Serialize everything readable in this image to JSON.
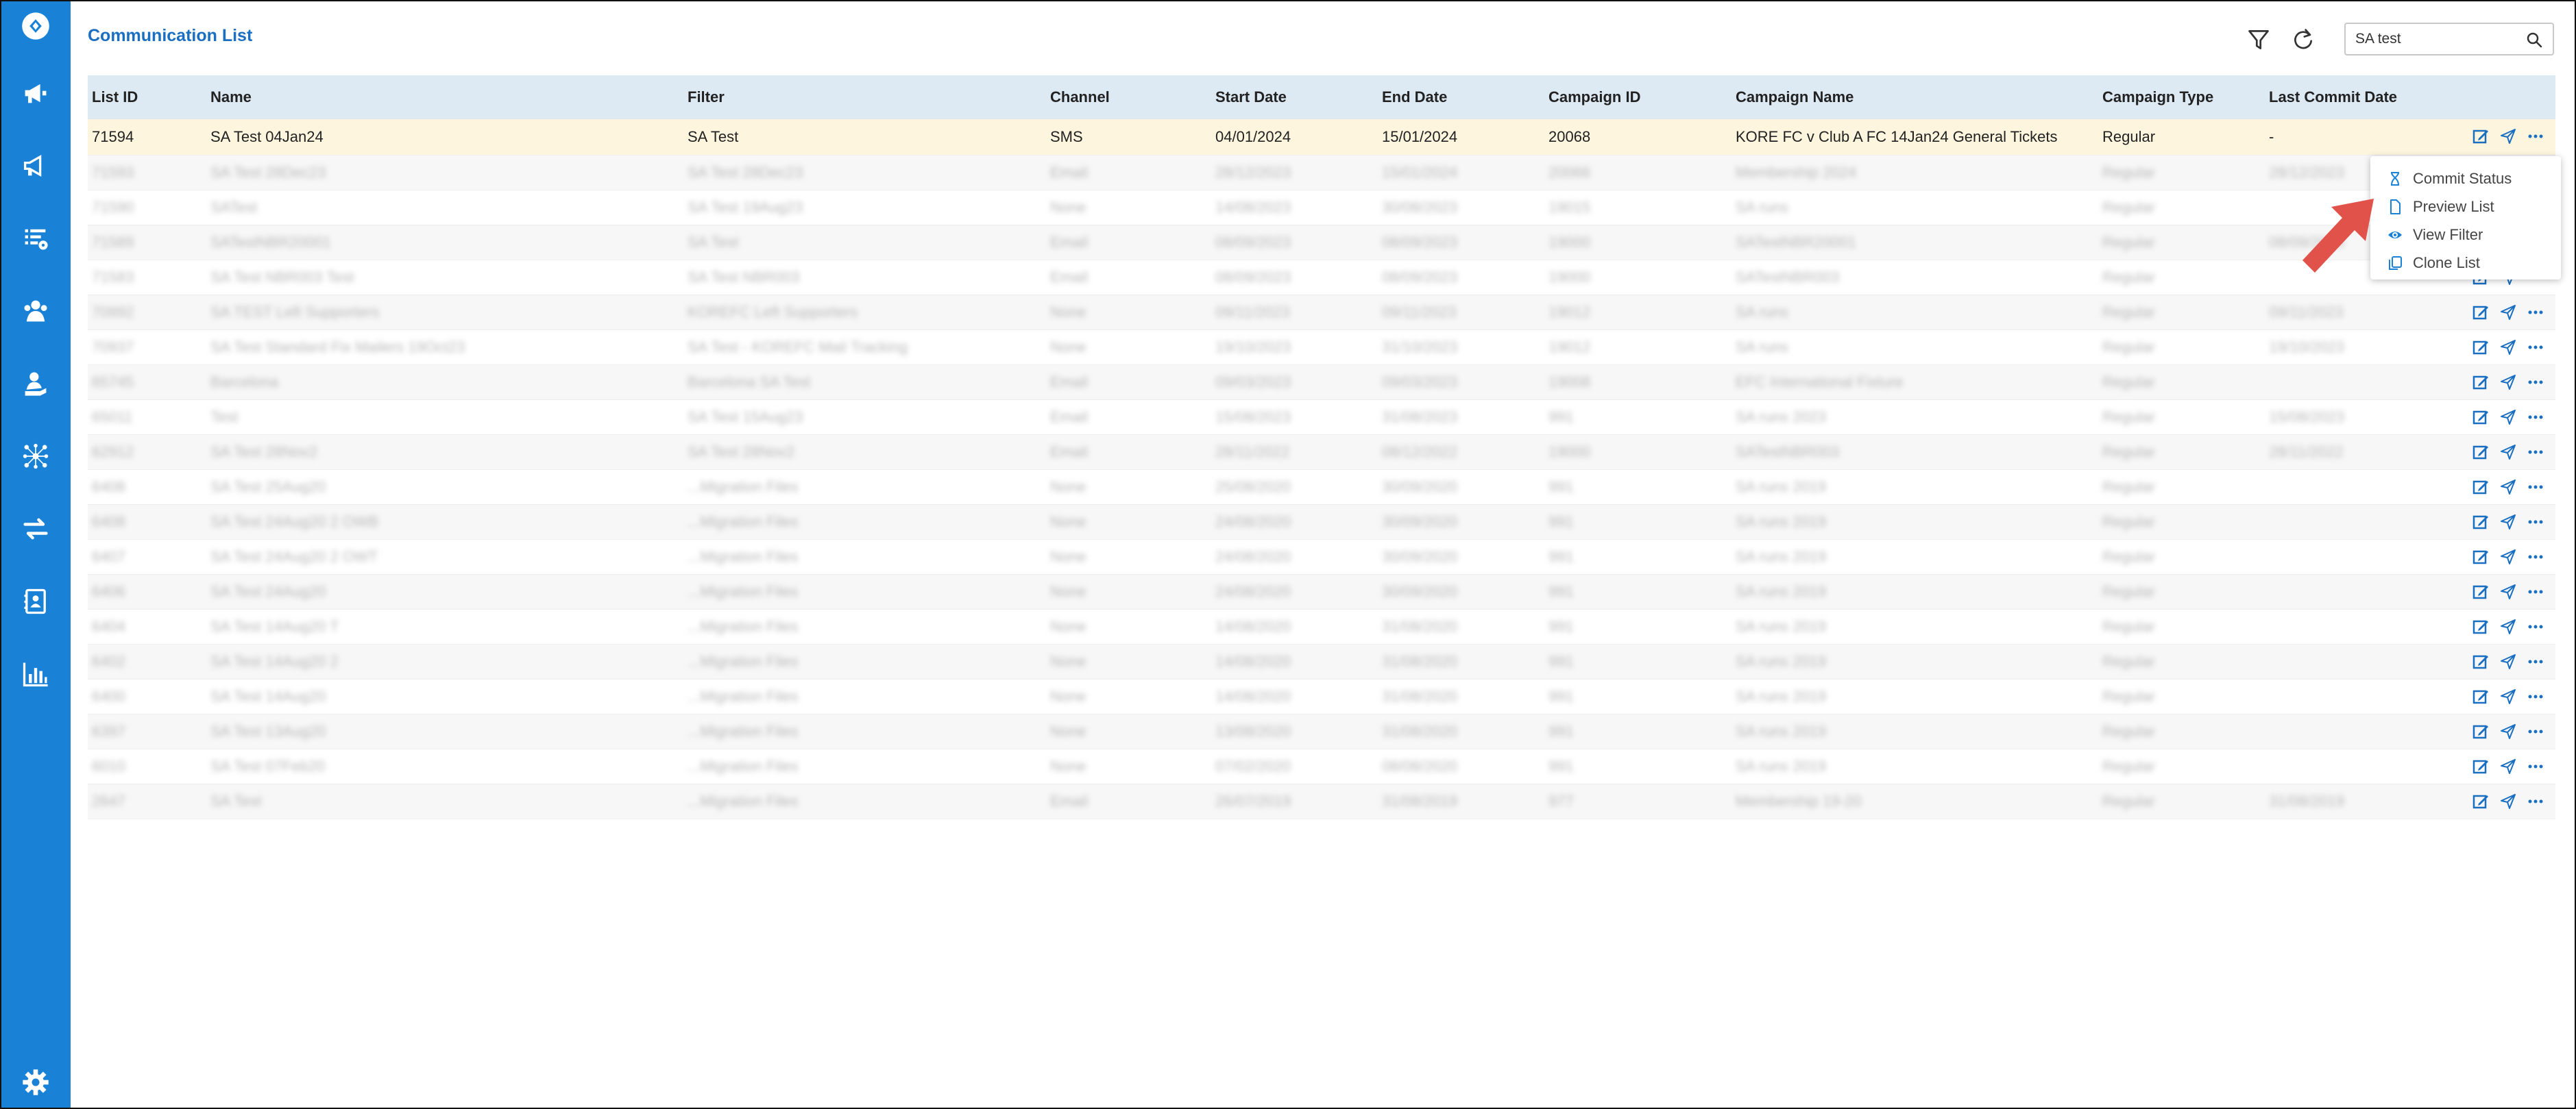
{
  "page": {
    "title": "Communication List"
  },
  "search": {
    "value": "SA test",
    "placeholder": ""
  },
  "sidebar": {
    "items": [
      {
        "icon": "logo-icon"
      },
      {
        "icon": "megaphone-icon"
      },
      {
        "icon": "megaphone-icon"
      },
      {
        "icon": "list-settings-icon"
      },
      {
        "icon": "users-icon"
      },
      {
        "icon": "user-hand-icon"
      },
      {
        "icon": "network-icon"
      },
      {
        "icon": "transfer-icon"
      },
      {
        "icon": "contact-card-icon"
      },
      {
        "icon": "bar-chart-icon"
      },
      {
        "icon": "gear-icon"
      }
    ]
  },
  "table": {
    "headers": [
      "List ID",
      "Name",
      "Filter",
      "Channel",
      "Start Date",
      "End Date",
      "Campaign ID",
      "Campaign Name",
      "Campaign Type",
      "Last Commit Date"
    ],
    "selected_row": [
      "71594",
      "SA Test 04Jan24",
      "SA Test",
      "SMS",
      "04/01/2024",
      "15/01/2024",
      "20068",
      "KORE FC v Club A FC 14Jan24 General Tickets",
      "Regular",
      "-"
    ],
    "blurred_rows": [
      [
        "71593",
        "SA Test 28Dec23",
        "SA Test 28Dec23",
        "Email",
        "28/12/2023",
        "15/01/2024",
        "20066",
        "Membership 2024",
        "Regular",
        "28/12/2023"
      ],
      [
        "71590",
        "SATest",
        "SA Test 19Aug23",
        "None",
        "14/08/2023",
        "30/08/2023",
        "19015",
        "SA runs",
        "Regular",
        ""
      ],
      [
        "71589",
        "SATestNBR20001",
        "SA Test",
        "Email",
        "08/09/2023",
        "08/09/2023",
        "19000",
        "SATestNBR20001",
        "Regular",
        "08/09/2023"
      ],
      [
        "71583",
        "SA Test NBR003 Test",
        "SA Test NBR003",
        "Email",
        "08/09/2023",
        "08/09/2023",
        "19000",
        "SATestNBR003",
        "Regular",
        ""
      ],
      [
        "70992",
        "SA TEST Left Supporters",
        "KOREFC Left Supporters",
        "None",
        "09/11/2023",
        "09/11/2023",
        "19012",
        "SA runs",
        "Regular",
        "09/11/2023"
      ],
      [
        "70937",
        "SA Test Standard Fix Mailers 19Oct23",
        "SA Test - KOREFC Mail Tracking",
        "None",
        "19/10/2023",
        "31/10/2023",
        "19012",
        "SA runs",
        "Regular",
        "19/10/2023"
      ],
      [
        "65745",
        "Barcelona",
        "Barcelona SA Test",
        "Email",
        "09/03/2023",
        "09/03/2023",
        "19008",
        "EFC International Fixture",
        "Regular",
        ""
      ],
      [
        "65011",
        "Test",
        "SA Test 15Aug23",
        "Email",
        "15/08/2023",
        "31/08/2023",
        "991",
        "SA runs 2023",
        "Regular",
        "15/08/2023"
      ],
      [
        "62912",
        "SA Test 28Nov2",
        "SA Test 28Nov2",
        "Email",
        "28/11/2022",
        "08/12/2022",
        "19000",
        "SATestNBR003",
        "Regular",
        "28/11/2022"
      ],
      [
        "6408",
        "SA Test 25Aug20",
        "...Migration Files",
        "None",
        "25/08/2020",
        "30/09/2020",
        "991",
        "SA runs 2019",
        "Regular",
        ""
      ],
      [
        "6408",
        "SA Test 24Aug20 2 OWB",
        "...Migration Files",
        "None",
        "24/08/2020",
        "30/09/2020",
        "991",
        "SA runs 2019",
        "Regular",
        ""
      ],
      [
        "6407",
        "SA Test 24Aug20 2 OWT",
        "...Migration Files",
        "None",
        "24/08/2020",
        "30/09/2020",
        "991",
        "SA runs 2019",
        "Regular",
        ""
      ],
      [
        "6406",
        "SA Test 24Aug20",
        "...Migration Files",
        "None",
        "24/08/2020",
        "30/09/2020",
        "991",
        "SA runs 2019",
        "Regular",
        ""
      ],
      [
        "6404",
        "SA Test 14Aug20 T",
        "...Migration Files",
        "None",
        "14/08/2020",
        "31/08/2020",
        "991",
        "SA runs 2019",
        "Regular",
        ""
      ],
      [
        "6402",
        "SA Test 14Aug20 2",
        "...Migration Files",
        "None",
        "14/08/2020",
        "31/08/2020",
        "991",
        "SA runs 2019",
        "Regular",
        ""
      ],
      [
        "6400",
        "SA Test 14Aug20",
        "...Migration Files",
        "None",
        "14/08/2020",
        "31/08/2020",
        "991",
        "SA runs 2019",
        "Regular",
        ""
      ],
      [
        "6397",
        "SA Test 13Aug20",
        "...Migration Files",
        "None",
        "13/08/2020",
        "31/08/2020",
        "991",
        "SA runs 2019",
        "Regular",
        ""
      ],
      [
        "6010",
        "SA Test 07Feb20",
        "...Migration Files",
        "None",
        "07/02/2020",
        "08/08/2020",
        "991",
        "SA runs 2019",
        "Regular",
        ""
      ],
      [
        "2647",
        "SA Test",
        "...Migration Files",
        "Email",
        "26/07/2019",
        "31/08/2019",
        "977",
        "Membership 19-20",
        "Regular",
        "31/08/2019"
      ]
    ]
  },
  "context_menu": {
    "items": [
      {
        "label": "Commit Status",
        "icon": "hourglass-icon"
      },
      {
        "label": "Preview List",
        "icon": "document-icon"
      },
      {
        "label": "View Filter",
        "icon": "eye-icon"
      },
      {
        "label": "Clone List",
        "icon": "copy-icon"
      }
    ]
  },
  "colors": {
    "sidebar": "#1a82d6",
    "accent": "#1a6fc0",
    "arrow": "#e0524a",
    "selected_row": "#fdf5dd",
    "header_row": "#dde9f3"
  }
}
